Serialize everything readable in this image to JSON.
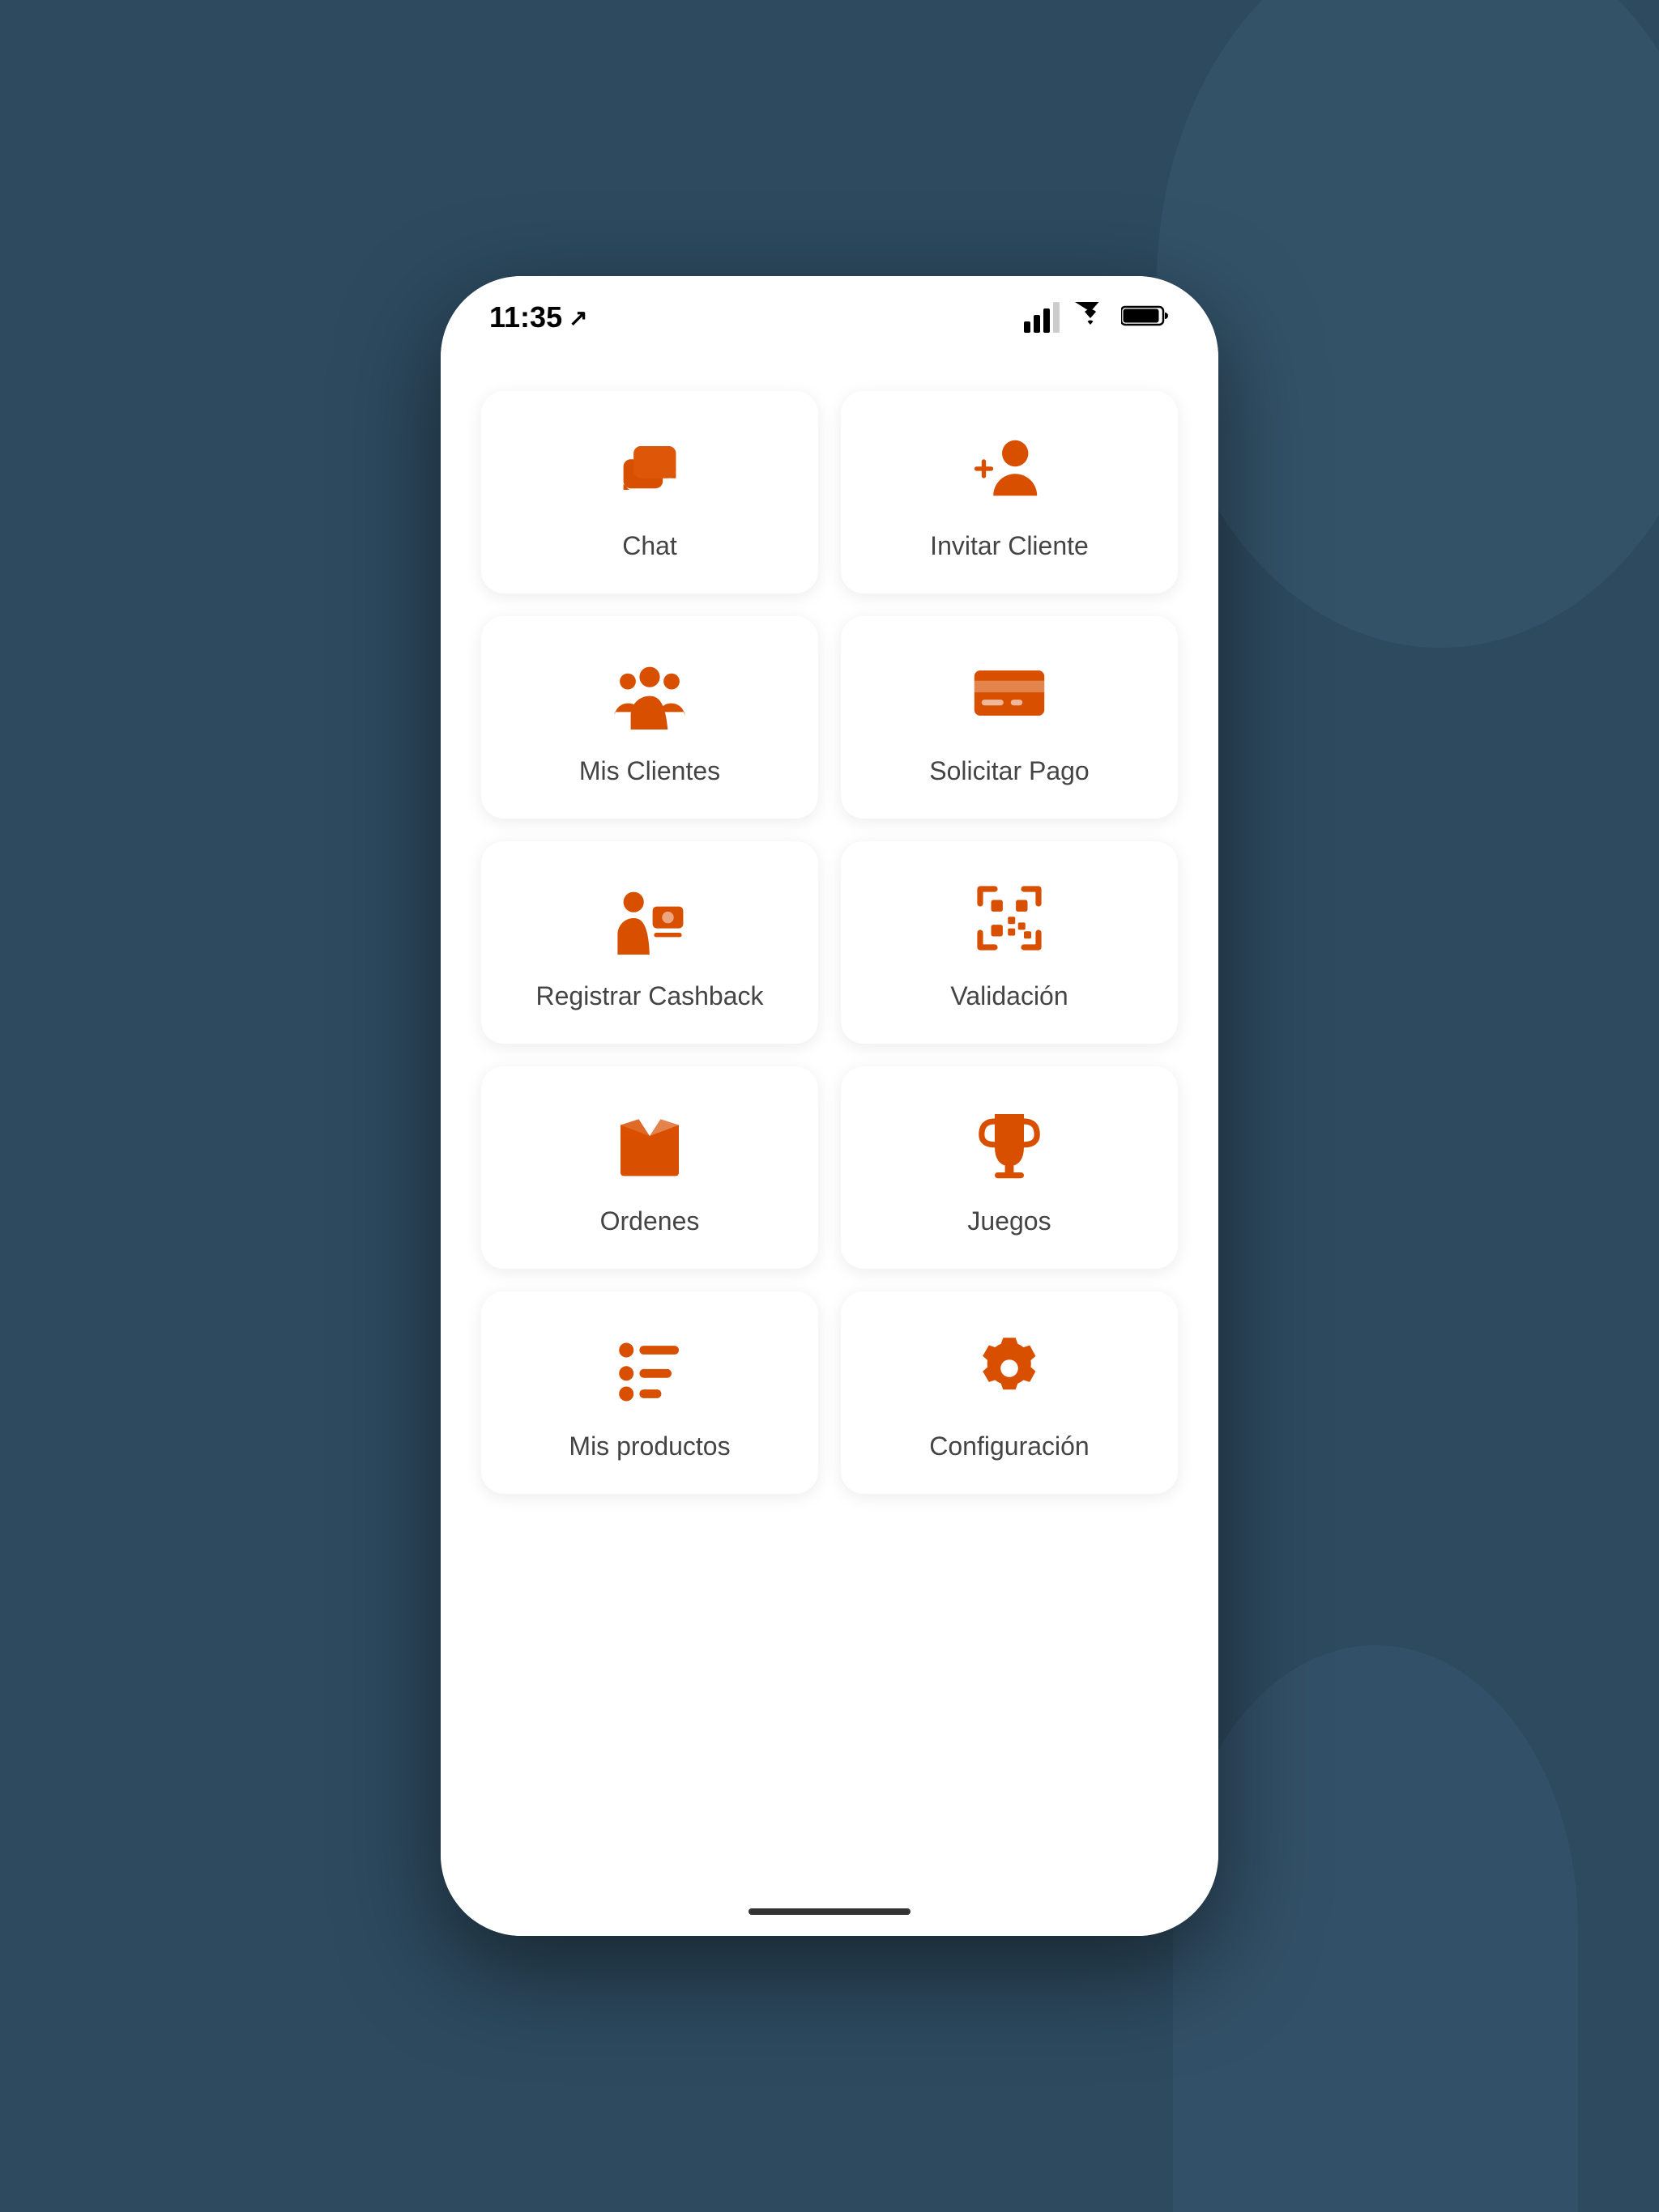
{
  "status_bar": {
    "time": "11:35",
    "location_icon": "↗"
  },
  "menu_items": [
    {
      "id": "chat",
      "label": "Chat",
      "icon": "chat"
    },
    {
      "id": "invitar-cliente",
      "label": "Invitar Cliente",
      "icon": "add-person"
    },
    {
      "id": "mis-clientes",
      "label": "Mis Clientes",
      "icon": "group"
    },
    {
      "id": "solicitar-pago",
      "label": "Solicitar Pago",
      "icon": "credit-card"
    },
    {
      "id": "registrar-cashback",
      "label": "Registrar Cashback",
      "icon": "cashback"
    },
    {
      "id": "validacion",
      "label": "Validación",
      "icon": "qr-code"
    },
    {
      "id": "ordenes",
      "label": "Ordenes",
      "icon": "box"
    },
    {
      "id": "juegos",
      "label": "Juegos",
      "icon": "trophy"
    },
    {
      "id": "mis-productos",
      "label": "Mis productos",
      "icon": "list"
    },
    {
      "id": "configuracion",
      "label": "Configuración",
      "icon": "gear"
    }
  ],
  "colors": {
    "accent": "#d94f00",
    "text": "#444444",
    "background": "#ffffff",
    "card_shadow": "rgba(0,0,0,0.08)"
  }
}
